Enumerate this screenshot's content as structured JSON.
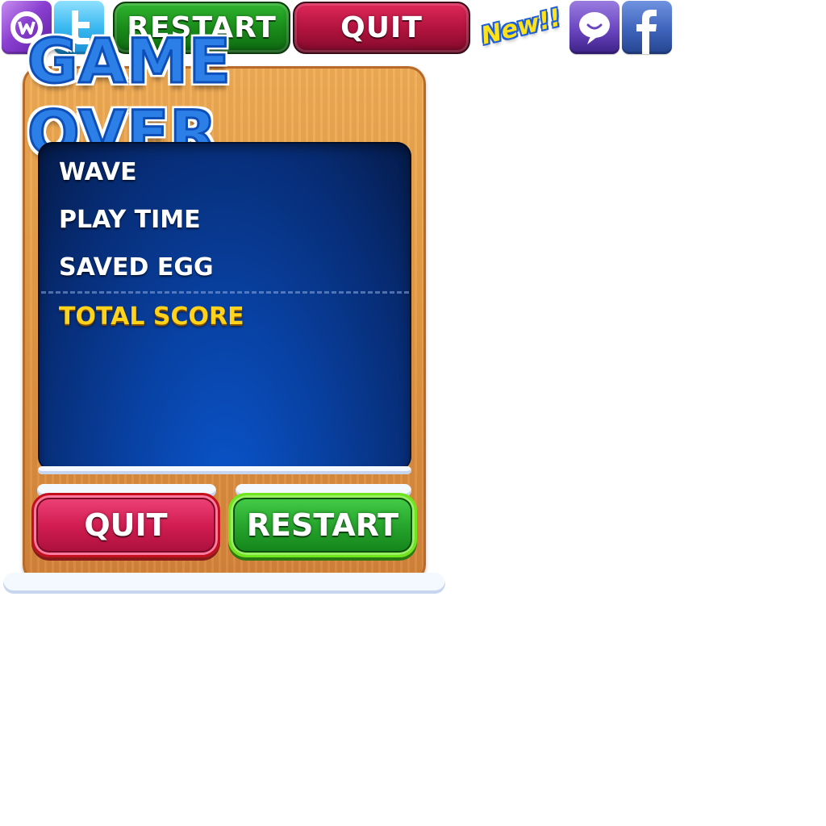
{
  "sprites": {
    "top_restart_label": "RESTART",
    "top_quit_label": "QUIT",
    "new_badge": "New!!",
    "icons": [
      "purple-w-icon",
      "twitter-icon",
      "chat-bubble-icon",
      "facebook-icon"
    ]
  },
  "game_over": {
    "title": "GAME OVER",
    "rows": {
      "wave": "WAVE",
      "play_time": "PLAY TIME",
      "saved_egg": "SAVED EGG",
      "total_score": "TOTAL SCORE"
    },
    "quit_label": "QUIT",
    "restart_label": "RESTART"
  },
  "colors": {
    "restart_green": "#1a8c1a",
    "quit_red": "#b3143f",
    "panel_blue": "#0840a0",
    "total_score_yellow": "#ffd21c",
    "wood": "#e59a43"
  }
}
